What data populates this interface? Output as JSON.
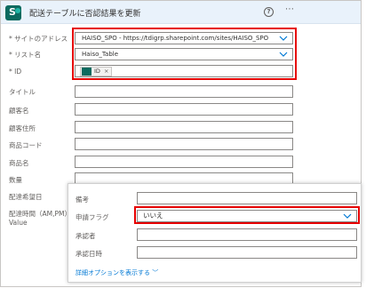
{
  "header": {
    "title": "配送テーブルに否認結果を更新",
    "help_glyph": "?",
    "more_glyph": "⋯",
    "icon_letter": "S"
  },
  "fields": [
    {
      "label": "* サイトのアドレス",
      "value": "HAISO_SPO - https://tdigrp.sharepoint.com/sites/HAISO_SPO"
    },
    {
      "label": "* リスト名",
      "value": "Haiso_Table"
    },
    {
      "label": "* ID",
      "token": "ID"
    },
    {
      "label": "タイトル",
      "value": ""
    },
    {
      "label": "顧客名",
      "value": ""
    },
    {
      "label": "顧客住所",
      "value": ""
    },
    {
      "label": "商品コード",
      "value": ""
    },
    {
      "label": "商品名",
      "value": ""
    },
    {
      "label": "数量",
      "value": ""
    },
    {
      "label": "配達希望日",
      "value": ""
    },
    {
      "label": "配達時間（AM,PM）Value",
      "value": ""
    }
  ],
  "overlay": {
    "fields": [
      {
        "label": "備考",
        "value": ""
      },
      {
        "label": "申請フラグ",
        "value": "いいえ"
      },
      {
        "label": "承認者",
        "value": ""
      },
      {
        "label": "承認日時",
        "value": ""
      }
    ],
    "advanced_link": "詳細オプションを表示する ﹀"
  },
  "token_close": "×",
  "colors": {
    "highlight": "#e60000",
    "link": "#0078d4",
    "brand": "#0b6a5f"
  }
}
